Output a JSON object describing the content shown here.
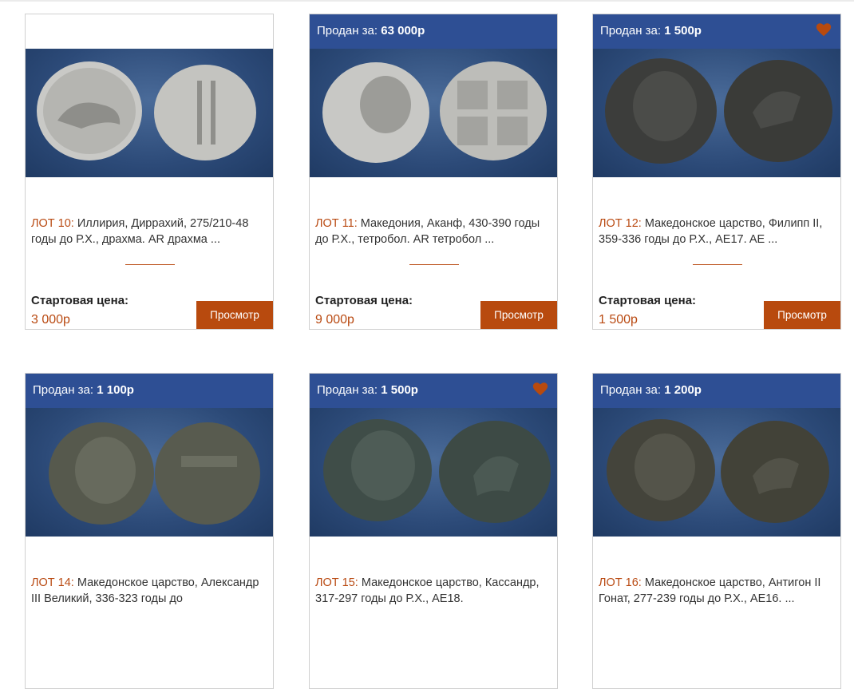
{
  "colors": {
    "header_blue": "#2e4f94",
    "accent_orange": "#b84a0e",
    "lot_text": "#b94a12"
  },
  "sold_label": "Продан за:",
  "start_price_label": "Стартовая цена:",
  "view_button_label": "Просмотр",
  "lots": [
    {
      "sold_price": "",
      "favorite": false,
      "lot_label": "ЛОТ 10:",
      "description": "Иллирия, Диррахий, 275/210-48 годы до Р.Х., драхма. AR драхма ...",
      "start_price": "3 000р"
    },
    {
      "sold_price": "63 000р",
      "favorite": false,
      "lot_label": "ЛОТ 11:",
      "description": "Македония, Аканф, 430-390 годы до Р.Х., тетробол. AR тетробол ...",
      "start_price": "9 000р"
    },
    {
      "sold_price": "1 500р",
      "favorite": true,
      "lot_label": "ЛОТ 12:",
      "description": "Македонское царство, Филипп II, 359-336 годы до Р.Х., AE17. AE ...",
      "start_price": "1 500р"
    },
    {
      "sold_price": "1 100р",
      "favorite": false,
      "lot_label": "ЛОТ 14:",
      "description": "Македонское царство, Александр III Великий, 336-323 годы до"
    },
    {
      "sold_price": "1 500р",
      "favorite": true,
      "lot_label": "ЛОТ 15:",
      "description": "Македонское царство, Кассандр, 317-297 годы до Р.Х., AE18."
    },
    {
      "sold_price": "1 200р",
      "favorite": false,
      "lot_label": "ЛОТ 16:",
      "description": "Македонское царство, Антигон II Гонат, 277-239 годы до Р.Х., AE16. ..."
    }
  ]
}
